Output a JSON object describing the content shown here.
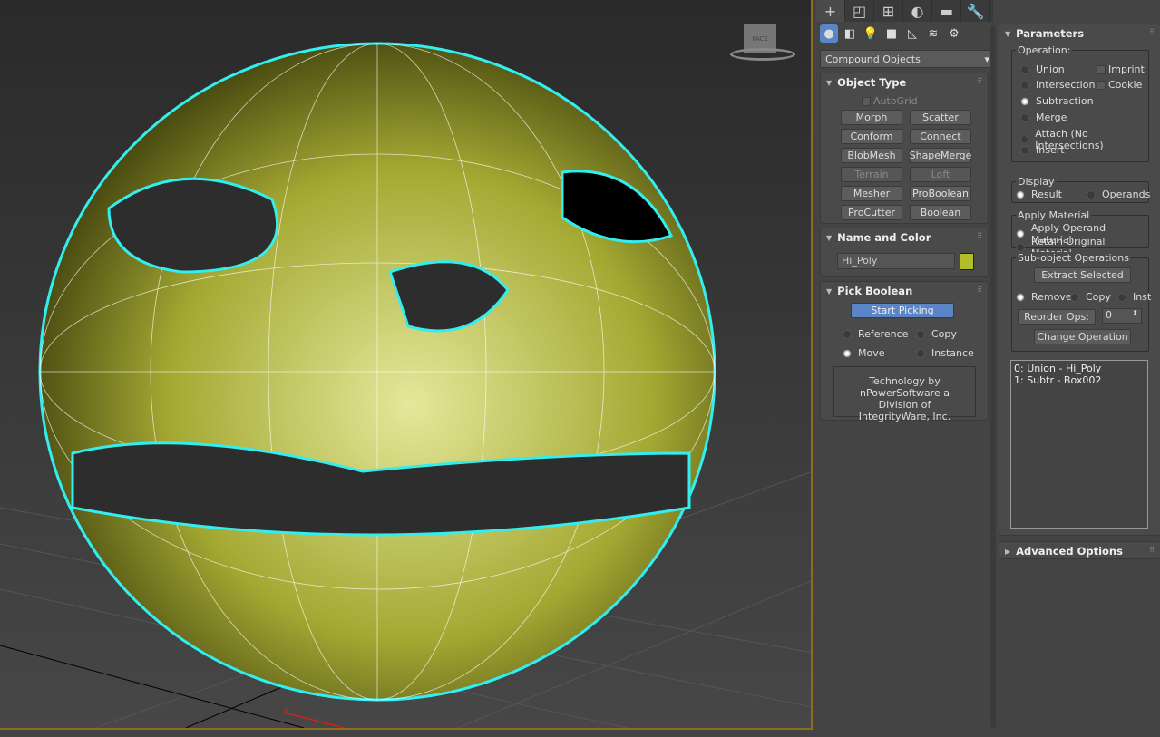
{
  "viewport": {
    "axis_label": "X",
    "viewcube_label": "FACE"
  },
  "command_panel": {
    "tabs": [
      {
        "icon": "create-icon",
        "glyph": "+"
      },
      {
        "icon": "modify-icon",
        "glyph": "◰"
      },
      {
        "icon": "hierarchy-icon",
        "glyph": "⊞"
      },
      {
        "icon": "motion-icon",
        "glyph": "◐"
      },
      {
        "icon": "display-icon",
        "glyph": "▬"
      },
      {
        "icon": "utilities-icon",
        "glyph": "🔧"
      }
    ],
    "categories": [
      {
        "icon": "geometry-icon",
        "glyph": "●"
      },
      {
        "icon": "shapes-icon",
        "glyph": "◧"
      },
      {
        "icon": "lights-icon",
        "glyph": "💡"
      },
      {
        "icon": "cameras-icon",
        "glyph": "■"
      },
      {
        "icon": "helpers-icon",
        "glyph": "◺"
      },
      {
        "icon": "spacewarps-icon",
        "glyph": "≋"
      },
      {
        "icon": "systems-icon",
        "glyph": "⚙"
      }
    ],
    "dropdown": {
      "value": "Compound Objects"
    },
    "object_type": {
      "title": "Object Type",
      "autogrid": "AutoGrid",
      "buttons": [
        "Morph",
        "Scatter",
        "Conform",
        "Connect",
        "BlobMesh",
        "ShapeMerge",
        "Terrain",
        "Loft",
        "Mesher",
        "ProBoolean",
        "ProCutter",
        "Boolean"
      ]
    },
    "name_color": {
      "title": "Name and Color",
      "name": "Hi_Poly",
      "color": "#b2bd2a"
    },
    "pick_boolean": {
      "title": "Pick Boolean",
      "start": "Start Picking",
      "reference": "Reference",
      "copy": "Copy",
      "move": "Move",
      "instance": "Instance",
      "tech": "Technology by nPowerSoftware a Division of IntegrityWare, Inc."
    },
    "parameters": {
      "title": "Parameters",
      "operation_label": "Operation:",
      "ops": [
        "Union",
        "Intersection",
        "Subtraction",
        "Merge",
        "Attach (No Intersections)",
        "Insert"
      ],
      "imprint": "Imprint",
      "cookie": "Cookie",
      "display_label": "Display",
      "result": "Result",
      "operands": "Operands",
      "apply_label": "Apply Material",
      "apply_operand": "Apply Operand Material",
      "retain": "Retain Original Material",
      "subobj_label": "Sub-object Operations",
      "extract": "Extract Selected",
      "remove": "Remove",
      "copy": "Copy",
      "inst": "Inst",
      "reorder": "Reorder Ops:",
      "reorder_val": "0",
      "change": "Change Operation",
      "list": [
        "0: Union - Hi_Poly",
        "1: Subtr - Box002"
      ]
    },
    "advanced": {
      "title": "Advanced Options"
    }
  }
}
